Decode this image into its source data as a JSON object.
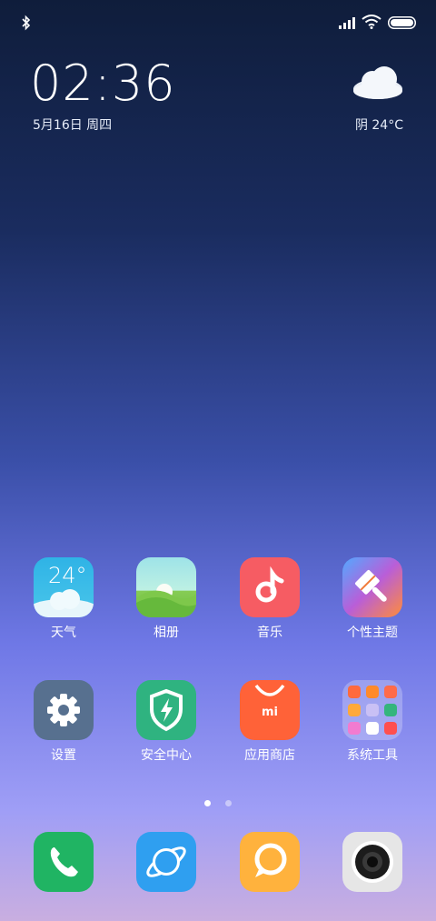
{
  "status": {
    "bluetooth_icon": "bluetooth-icon",
    "signal_icon": "signal-icon",
    "wifi_icon": "wifi-icon",
    "battery_icon": "battery-icon"
  },
  "clock": {
    "time": "02:36",
    "date": "5月16日 周四"
  },
  "weather": {
    "icon": "cloud-icon",
    "summary": "阴 24°C"
  },
  "apps": [
    {
      "label": "天气",
      "tile_text": "24°",
      "icon": "weather-app-icon"
    },
    {
      "label": "相册",
      "icon": "gallery-app-icon"
    },
    {
      "label": "音乐",
      "icon": "music-app-icon"
    },
    {
      "label": "个性主题",
      "icon": "themes-app-icon"
    },
    {
      "label": "设置",
      "icon": "settings-app-icon"
    },
    {
      "label": "安全中心",
      "icon": "security-app-icon"
    },
    {
      "label": "应用商店",
      "tile_text": "mi",
      "icon": "app-store-icon"
    },
    {
      "label": "系统工具",
      "icon": "system-tools-folder-icon"
    }
  ],
  "dock": [
    {
      "icon": "phone-icon"
    },
    {
      "icon": "browser-icon"
    },
    {
      "icon": "messages-icon"
    },
    {
      "icon": "camera-icon"
    }
  ],
  "pager": {
    "pages": 2,
    "active": 1
  },
  "colors": {
    "phone": "#20b463",
    "browser": "#2f9ff0",
    "messages": "#ffb23d",
    "music": "#f65c63",
    "store": "#ff6238",
    "security": "#2fb380",
    "settings": "#57708f"
  }
}
